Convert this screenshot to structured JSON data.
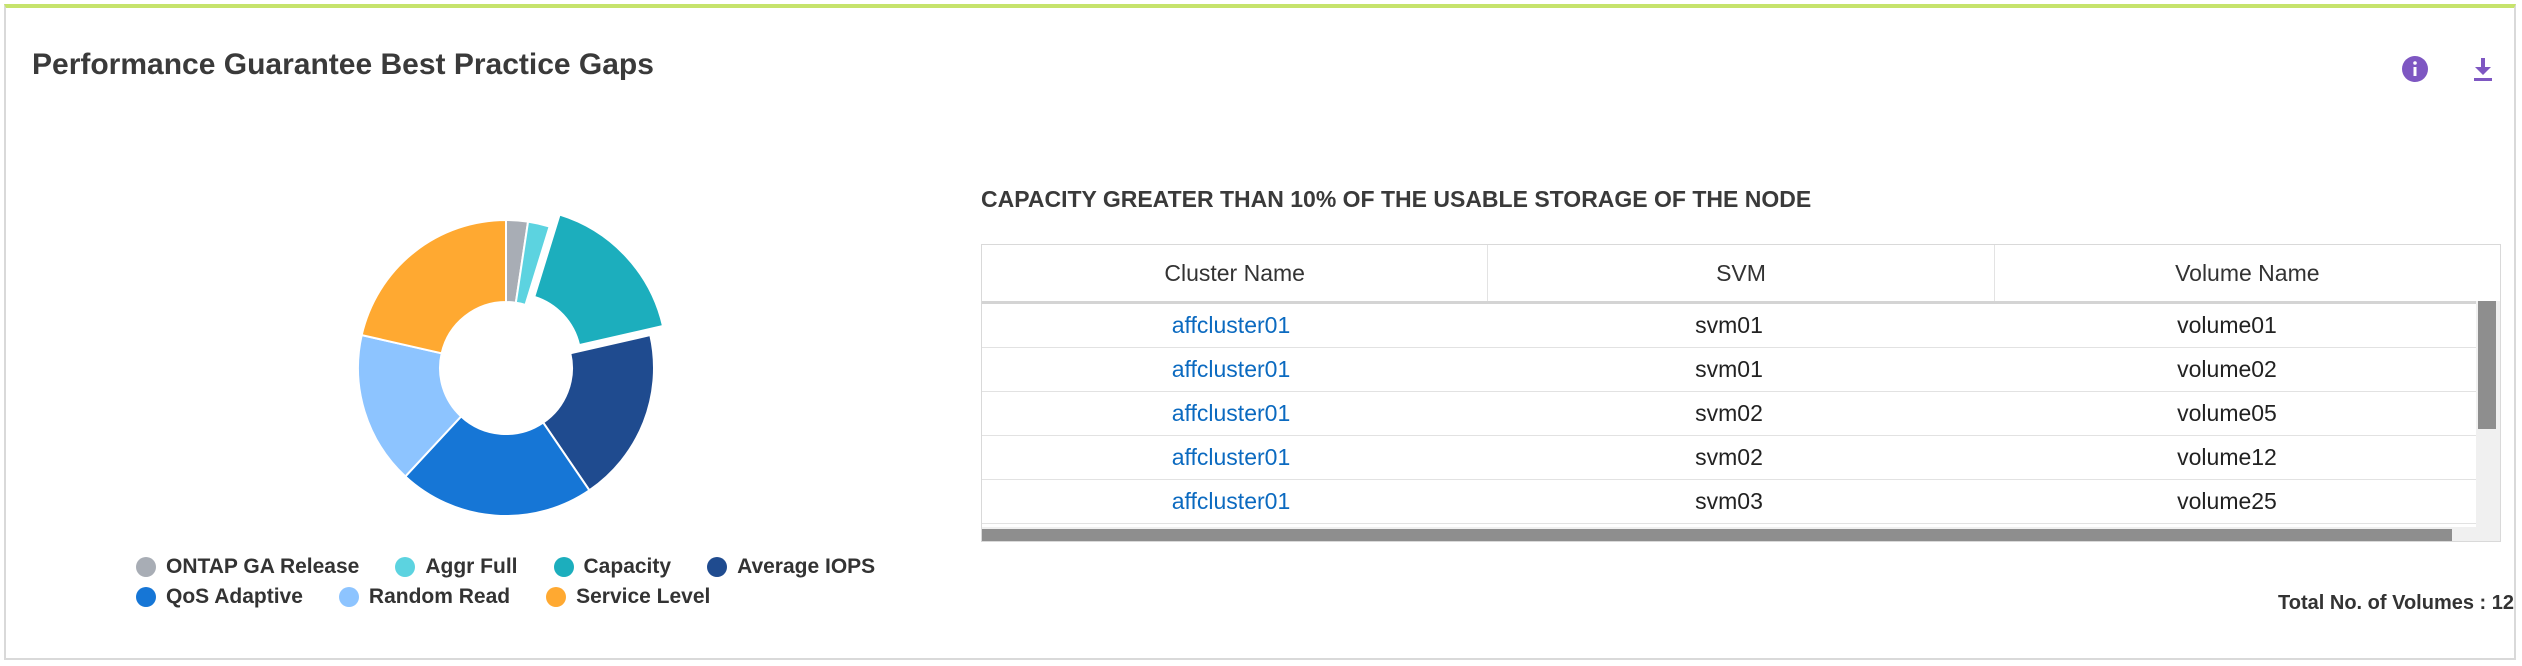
{
  "widget": {
    "title": "Performance Guarantee Best Practice Gaps",
    "info_icon": "info-icon",
    "download_icon": "download-icon",
    "accent_color": "#7e57c2",
    "top_border_color": "#c6e36c"
  },
  "chart_data": {
    "type": "pie",
    "style": "donut",
    "categories": [
      "ONTAP GA Release",
      "Aggr Full",
      "Capacity",
      "Average IOPS",
      "QoS Adaptive",
      "Random Read",
      "Service Level"
    ],
    "values": [
      1,
      1,
      7,
      8,
      9,
      7,
      9
    ],
    "colors": [
      "#a8adb5",
      "#5cd3e0",
      "#1caebd",
      "#1f4b8f",
      "#1676d6",
      "#8dc4ff",
      "#ffa931"
    ],
    "highlighted": "Capacity",
    "legend_position": "bottom"
  },
  "legend": {
    "items": [
      {
        "label": "ONTAP GA Release",
        "color": "#a8adb5"
      },
      {
        "label": "Aggr Full",
        "color": "#5cd3e0"
      },
      {
        "label": "Capacity",
        "color": "#1caebd"
      },
      {
        "label": "Average IOPS",
        "color": "#1f4b8f"
      },
      {
        "label": "QoS Adaptive",
        "color": "#1676d6"
      },
      {
        "label": "Random Read",
        "color": "#8dc4ff"
      },
      {
        "label": "Service Level",
        "color": "#ffa931"
      }
    ]
  },
  "detail": {
    "title": "CAPACITY GREATER THAN 10% OF THE USABLE STORAGE OF THE NODE",
    "columns": [
      "Cluster Name",
      "SVM",
      "Volume Name"
    ],
    "rows": [
      [
        "affcluster01",
        "svm01",
        "volume01"
      ],
      [
        "affcluster01",
        "svm01",
        "volume02"
      ],
      [
        "affcluster01",
        "svm02",
        "volume05"
      ],
      [
        "affcluster01",
        "svm02",
        "volume12"
      ],
      [
        "affcluster01",
        "svm03",
        "volume25"
      ]
    ],
    "total_label": "Total No. of Volumes : 12"
  }
}
